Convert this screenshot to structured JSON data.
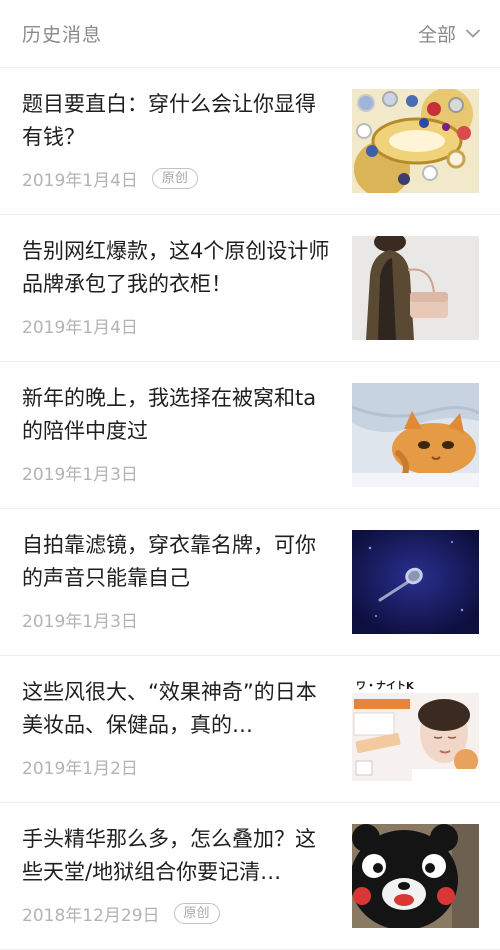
{
  "header": {
    "title": "历史消息",
    "filter_label": "全部"
  },
  "articles": [
    {
      "title": "题目要直白：穿什么会让你显得有钱？",
      "date": "2019年1月4日",
      "badge": "原创",
      "thumbnail": "jewelry-watches-image"
    },
    {
      "title": "告别网红爆款，这4个原创设计师品牌承包了我的衣柜！",
      "date": "2019年1月4日",
      "badge": "",
      "thumbnail": "woman-with-handbag-image"
    },
    {
      "title": "新年的晚上，我选择在被窝和ta的陪伴中度过",
      "date": "2019年1月3日",
      "badge": "",
      "thumbnail": "cat-under-blanket-image"
    },
    {
      "title": "自拍靠滤镜，穿衣靠名牌，可你的声音只能靠自己",
      "date": "2019年1月3日",
      "badge": "",
      "thumbnail": "microphone-image"
    },
    {
      "title": "这些风很大、“效果神奇”的日本美妆品、保健品，真的…",
      "date": "2019年1月2日",
      "badge": "",
      "thumbnail": "japanese-product-ad-image",
      "thumbnail_text": "ワ・ナイトK"
    },
    {
      "title": "手头精华那么多，怎么叠加？这些天堂/地狱组合你要记清…",
      "date": "2018年12月29日",
      "badge": "原创",
      "thumbnail": "kumamon-mascot-image"
    }
  ]
}
